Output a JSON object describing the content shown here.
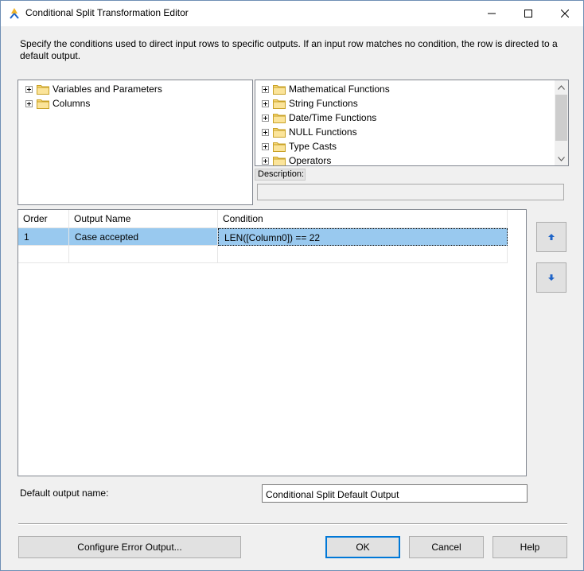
{
  "window": {
    "title": "Conditional Split Transformation Editor",
    "title_icon": "conditional-split-icon"
  },
  "instructions": "Specify the conditions used to direct input rows to specific outputs. If an input row matches no condition, the row is directed to a default output.",
  "left_tree": {
    "items": [
      {
        "label": "Variables and Parameters",
        "icon": "folder-icon"
      },
      {
        "label": "Columns",
        "icon": "folder-icon"
      }
    ]
  },
  "right_tree": {
    "items": [
      {
        "label": "Mathematical Functions",
        "icon": "folder-icon"
      },
      {
        "label": "String Functions",
        "icon": "folder-icon"
      },
      {
        "label": "Date/Time Functions",
        "icon": "folder-icon"
      },
      {
        "label": "NULL Functions",
        "icon": "folder-icon"
      },
      {
        "label": "Type Casts",
        "icon": "folder-icon"
      },
      {
        "label": "Operators",
        "icon": "folder-icon"
      }
    ]
  },
  "description": {
    "label": "Description:",
    "value": ""
  },
  "grid": {
    "columns": [
      "Order",
      "Output Name",
      "Condition"
    ],
    "rows": [
      {
        "order": "1",
        "output_name": "Case accepted",
        "condition": "LEN([Column0]) == 22"
      }
    ]
  },
  "default_output": {
    "label": "Default output name:",
    "value": "Conditional Split Default Output"
  },
  "buttons": {
    "configure_error": "Configure Error Output...",
    "ok": "OK",
    "cancel": "Cancel",
    "help": "Help"
  },
  "colors": {
    "selection": "#99c9ef",
    "default_button_border": "#0078d7",
    "arrow_blue": "#1e64c8"
  }
}
